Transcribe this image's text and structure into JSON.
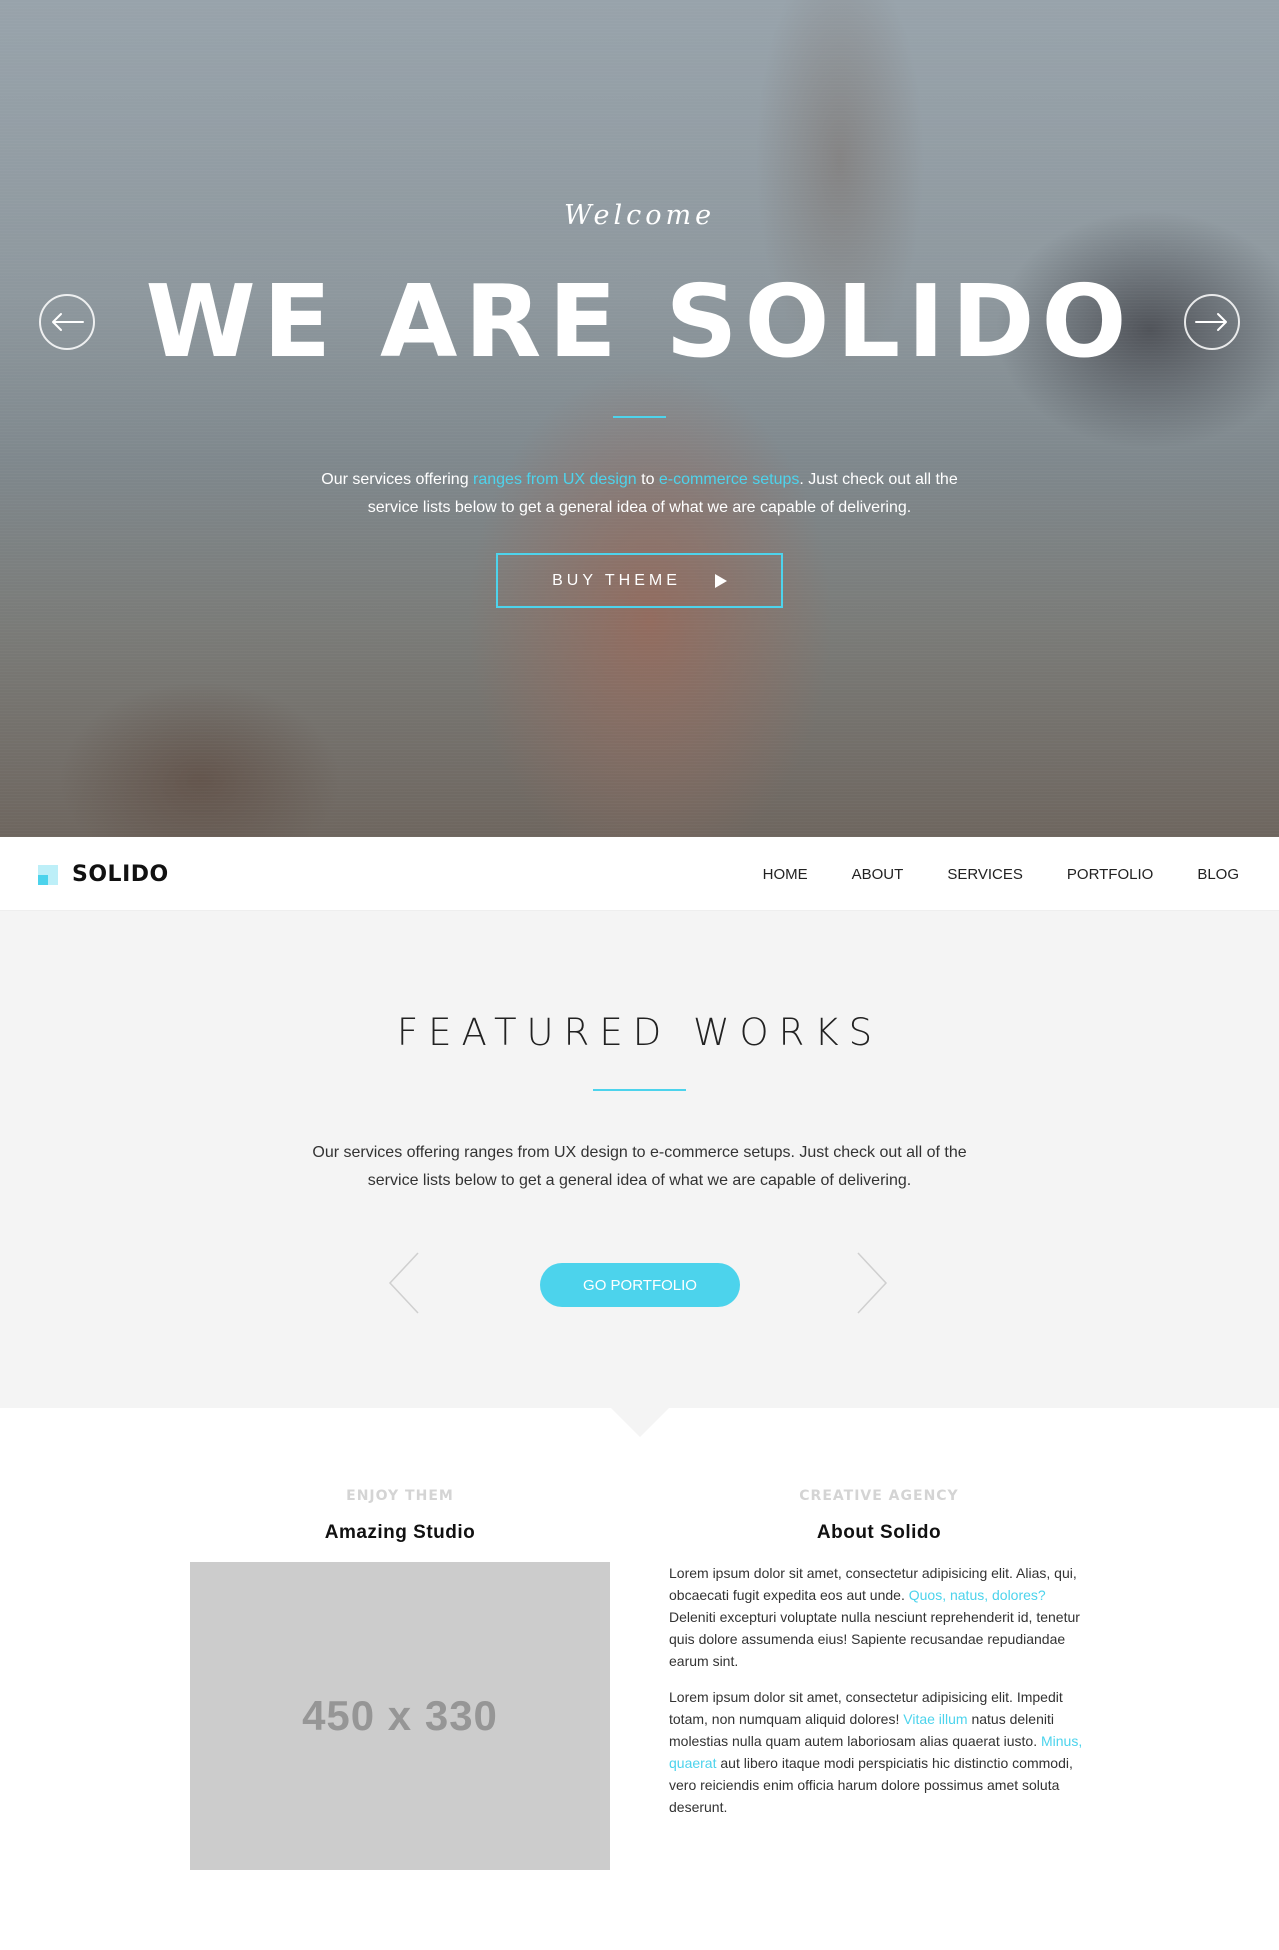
{
  "hero": {
    "welcome": "Welcome",
    "title": "WE ARE SOLIDO",
    "text": {
      "part1": "Our services offering ",
      "link1": "ranges from UX design",
      "part2": " to ",
      "link2": "e-commerce setups",
      "part3": ". Just check out all the service lists below to get a general idea of what we are capable of delivering."
    },
    "button_label": "BUY THEME",
    "prev_icon": "arrow-left-circle-icon",
    "next_icon": "arrow-right-circle-icon"
  },
  "navbar": {
    "logo": "SOLIDO",
    "items": [
      "HOME",
      "ABOUT",
      "SERVICES",
      "PORTFOLIO",
      "BLOG"
    ]
  },
  "featured": {
    "title": "FEATURED WORKS",
    "text": "Our services offering ranges from UX design to e-commerce setups. Just check out all of the service lists below to get a general idea of what we are capable of delivering.",
    "button_label": "GO PORTFOLIO",
    "prev_icon": "chevron-left-icon",
    "next_icon": "chevron-right-icon"
  },
  "studio": {
    "eyebrow": "ENJOY THEM",
    "title": "Amazing Studio",
    "image_label": "450 x 330"
  },
  "about": {
    "eyebrow": "CREATIVE AGENCY",
    "title": "About Solido",
    "p1": {
      "a": "Lorem ipsum dolor sit amet, consectetur adipisicing elit. Alias, qui, obcaecati fugit expedita eos aut unde. ",
      "link": "Quos, natus, dolores?",
      "b": " Deleniti excepturi voluptate nulla nesciunt reprehenderit id, tenetur quis dolore assumenda eius! Sapiente recusandae repudiandae earum sint."
    },
    "p2": {
      "a": "Lorem ipsum dolor sit amet, consectetur adipisicing elit. Impedit totam, non numquam aliquid dolores! ",
      "link1": "Vitae illum",
      "b": " natus deleniti molestias nulla quam autem laboriosam alias quaerat iusto. ",
      "link2": "Minus, quaerat",
      "c": " aut libero itaque modi perspiciatis hic distinctio commodi, vero reiciendis enim officia harum dolore possimus amet soluta deserunt."
    }
  },
  "colors": {
    "accent": "#4cd3ec",
    "section_bg": "#f4f4f4",
    "placeholder_bg": "#cccccc"
  }
}
